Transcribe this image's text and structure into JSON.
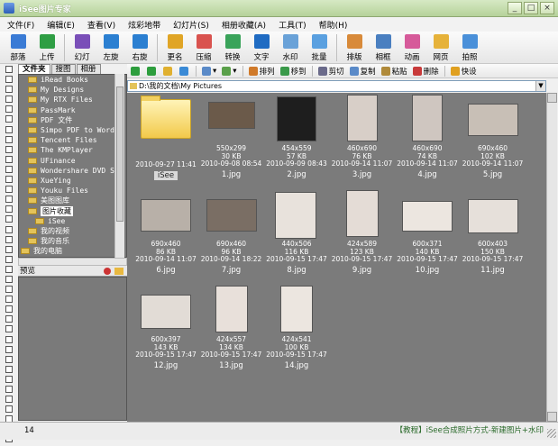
{
  "window": {
    "title": "iSee图片专家",
    "min_label": "_",
    "max_label": "□",
    "close_label": "×"
  },
  "menu": [
    "文件(F)",
    "编辑(E)",
    "查看(V)",
    "炫彩地带",
    "幻灯片(S)",
    "相册收藏(A)",
    "工具(T)",
    "帮助(H)"
  ],
  "toolbar": [
    {
      "label": "部落",
      "icon": "tribe-icon",
      "color": "#3a7bd5"
    },
    {
      "label": "上传",
      "icon": "upload-icon",
      "color": "#2f9e44"
    },
    {
      "label": "幻灯",
      "icon": "slideshow-icon",
      "color": "#7a4fb8"
    },
    {
      "label": "左旋",
      "icon": "rotate-left-icon",
      "color": "#2b7fd1"
    },
    {
      "label": "右旋",
      "icon": "rotate-right-icon",
      "color": "#2b7fd1"
    },
    {
      "label": "更名",
      "icon": "rename-icon",
      "color": "#e0a526"
    },
    {
      "label": "压缩",
      "icon": "compress-icon",
      "color": "#d9534f"
    },
    {
      "label": "转换",
      "icon": "convert-icon",
      "color": "#3aa35a"
    },
    {
      "label": "文字",
      "icon": "text-icon",
      "color": "#1f6bc2"
    },
    {
      "label": "水印",
      "icon": "watermark-icon",
      "color": "#6aa2d8"
    },
    {
      "label": "批量",
      "icon": "batch-icon",
      "color": "#5aa0e0"
    },
    {
      "label": "排版",
      "icon": "layout-icon",
      "color": "#d88a3a"
    },
    {
      "label": "相框",
      "icon": "photo-frame-icon",
      "color": "#4a7fc0"
    },
    {
      "label": "动画",
      "icon": "animation-icon",
      "color": "#d65a9a"
    },
    {
      "label": "网页",
      "icon": "webpage-icon",
      "color": "#e6b23a"
    },
    {
      "label": "拍照",
      "icon": "camera-icon",
      "color": "#4a90d9"
    }
  ],
  "left_tabs": [
    "文件夹",
    "搜图",
    "相册"
  ],
  "tree": [
    {
      "label": "iRead Books"
    },
    {
      "label": "My Designs"
    },
    {
      "label": "My RTX Files"
    },
    {
      "label": "PassMark"
    },
    {
      "label": "PDF 文件"
    },
    {
      "label": "Simpo PDF to Word"
    },
    {
      "label": "Tencent Files"
    },
    {
      "label": "The KMPlayer"
    },
    {
      "label": "UFinance"
    },
    {
      "label": "Wondershare DVD Sl"
    },
    {
      "label": "XueYing"
    },
    {
      "label": "Youku Files"
    },
    {
      "label": "美图图库"
    },
    {
      "label": "图片收藏",
      "selected": true
    },
    {
      "label": "iSee"
    },
    {
      "label": "我的视频"
    },
    {
      "label": "我的音乐"
    },
    {
      "label": "我的电脑"
    }
  ],
  "preview_label": "预览",
  "nav": {
    "sort_label": "排列",
    "move_label": "移到",
    "cut_label": "剪切",
    "copy_label": "复制",
    "paste_label": "粘贴",
    "delete_label": "删除",
    "shortcut_label": "快设"
  },
  "address": "D:\\我的文档\\My Pictures",
  "files": [
    {
      "name": "iSee",
      "folder": true,
      "date": "2010-09-27 11:41"
    },
    {
      "name": "1.jpg",
      "dims": "550x299",
      "size": "30 KB",
      "date": "2010-09-08 08:54"
    },
    {
      "name": "2.jpg",
      "dims": "454x559",
      "size": "57 KB",
      "date": "2010-09-09 08:43"
    },
    {
      "name": "3.jpg",
      "dims": "460x690",
      "size": "76 KB",
      "date": "2010-09-14 11:07"
    },
    {
      "name": "4.jpg",
      "dims": "460x690",
      "size": "74 KB",
      "date": "2010-09-14 11:07"
    },
    {
      "name": "5.jpg",
      "dims": "690x460",
      "size": "102 KB",
      "date": "2010-09-14 11:07"
    },
    {
      "name": "6.jpg",
      "dims": "690x460",
      "size": "86 KB",
      "date": "2010-09-14 11:07"
    },
    {
      "name": "7.jpg",
      "dims": "690x460",
      "size": "96 KB",
      "date": "2010-09-14 18:22"
    },
    {
      "name": "8.jpg",
      "dims": "440x506",
      "size": "116 KB",
      "date": "2010-09-15 17:47"
    },
    {
      "name": "9.jpg",
      "dims": "424x589",
      "size": "123 KB",
      "date": "2010-09-15 17:47"
    },
    {
      "name": "10.jpg",
      "dims": "600x371",
      "size": "140 KB",
      "date": "2010-09-15 17:47"
    },
    {
      "name": "11.jpg",
      "dims": "600x403",
      "size": "150 KB",
      "date": "2010-09-15 17:47"
    },
    {
      "name": "12.jpg",
      "dims": "600x397",
      "size": "143 KB",
      "date": "2010-09-15 17:47"
    },
    {
      "name": "13.jpg",
      "dims": "424x557",
      "size": "134 KB",
      "date": "2010-09-15 17:47"
    },
    {
      "name": "14.jpg",
      "dims": "424x541",
      "size": "100 KB",
      "date": "2010-09-15 17:47"
    }
  ],
  "status": {
    "count": "14",
    "tip": "【教程】iSee合成照片方式-新建图片+水印"
  }
}
